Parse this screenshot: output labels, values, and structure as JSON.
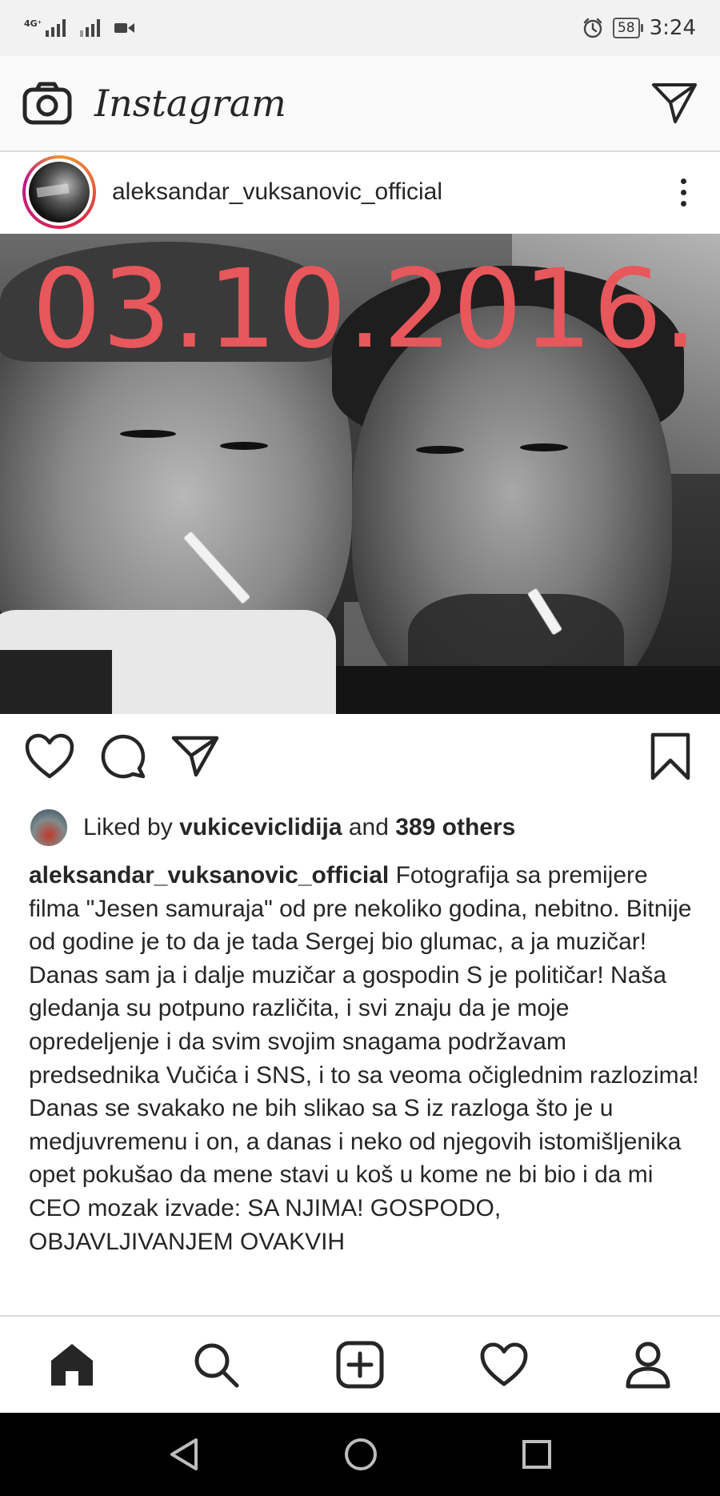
{
  "status_bar": {
    "network_label": "4G⁺",
    "battery_level": "58",
    "time": "3:24",
    "icons": [
      "signal-icon",
      "signal-icon",
      "video-icon",
      "alarm-icon",
      "battery-icon"
    ]
  },
  "header": {
    "logo_text": "Instagram",
    "icons": [
      "camera-icon",
      "direct-message-icon"
    ]
  },
  "post": {
    "username": "aleksandar_vuksanovic_official",
    "photo_overlay_text": "03.10.2016.",
    "overlay_color": "#e8575b",
    "action_icons": [
      "heart-icon",
      "comment-icon",
      "share-icon",
      "bookmark-icon"
    ],
    "likes": {
      "prefix": "Liked by ",
      "user": "vukiceviclidija",
      "joiner": " and ",
      "count_text": "389 others"
    },
    "caption": {
      "author": "aleksandar_vuksanovic_official",
      "text": " Fotografija sa premijere filma \"Jesen samuraja\" od pre nekoliko godina, nebitno. Bitnije od godine je to da je tada Sergej bio glumac, a ja muzičar! Danas sam ja i dalje muzičar a gospodin S je političar! Naša gledanja su potpuno različita, i svi znaju da je moje opredeljenje i da svim svojim snagama podržavam predsednika Vučića i SNS, i to sa veoma očiglednim razlozima! Danas se svakako ne bih slikao sa S iz razloga što je u medjuvremenu i on, a danas i neko od njegovih istomišljenika opet pokušao da mene stavi u koš u kome ne bi bio i da mi CEO mozak izvade: SA NJIMA! GOSPODO, OBJAVLJIVANJEM OVAKVIH"
    }
  },
  "bottom_nav": {
    "items": [
      "home-icon",
      "search-icon",
      "new-post-icon",
      "activity-icon",
      "profile-icon"
    ]
  },
  "android_nav": {
    "items": [
      "back-icon",
      "home-circle-icon",
      "recents-icon"
    ]
  },
  "colors": {
    "accent_red": "#e8575b",
    "text": "#262626",
    "status_bar_bg": "#f2f2f2",
    "header_bg": "#fafafa"
  }
}
